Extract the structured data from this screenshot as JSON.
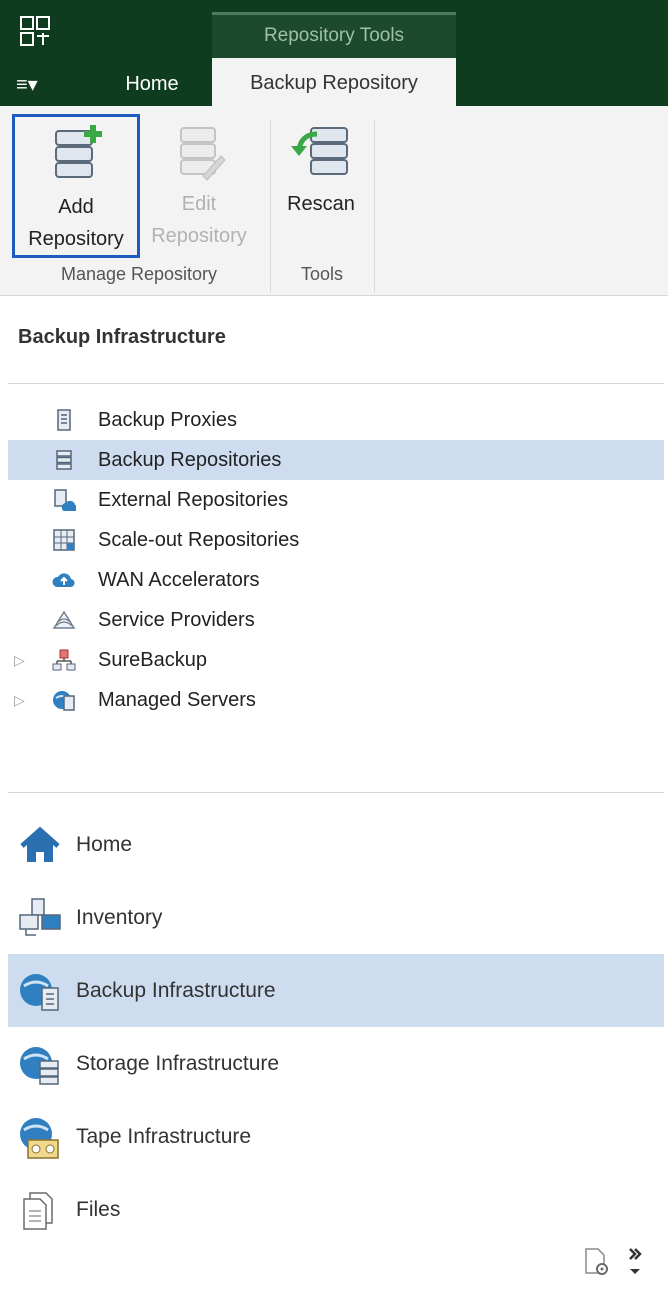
{
  "titlebar": {
    "context_tab": "Repository Tools",
    "menu_label": "≡▾",
    "tabs": [
      {
        "label": "Home"
      },
      {
        "label": "Backup Repository"
      }
    ]
  },
  "ribbon": {
    "add_line1": "Add",
    "add_line2": "Repository",
    "edit_line1": "Edit",
    "edit_line2": "Repository",
    "rescan": "Rescan",
    "group_manage": "Manage Repository",
    "group_tools": "Tools"
  },
  "pane": {
    "title": "Backup Infrastructure"
  },
  "tree": {
    "items": [
      {
        "label": "Backup Proxies",
        "icon": "server-icon"
      },
      {
        "label": "Backup Repositories",
        "icon": "database-icon"
      },
      {
        "label": "External Repositories",
        "icon": "cloud-server-icon"
      },
      {
        "label": "Scale-out Repositories",
        "icon": "scale-out-icon"
      },
      {
        "label": "WAN Accelerators",
        "icon": "cloud-upload-icon"
      },
      {
        "label": "Service Providers",
        "icon": "service-provider-icon"
      },
      {
        "label": "SureBackup",
        "icon": "surebackup-icon"
      },
      {
        "label": "Managed Servers",
        "icon": "managed-servers-icon"
      }
    ]
  },
  "nav": {
    "items": [
      {
        "label": "Home",
        "icon": "home-icon"
      },
      {
        "label": "Inventory",
        "icon": "inventory-icon"
      },
      {
        "label": "Backup Infrastructure",
        "icon": "backup-infrastructure-icon"
      },
      {
        "label": "Storage Infrastructure",
        "icon": "storage-infrastructure-icon"
      },
      {
        "label": "Tape Infrastructure",
        "icon": "tape-infrastructure-icon"
      },
      {
        "label": "Files",
        "icon": "files-icon"
      }
    ]
  },
  "colors": {
    "titlebar": "#0f3b1e",
    "selection": "#cddcee",
    "focus_border": "#1e5bbf",
    "accent_green": "#3aa845"
  }
}
